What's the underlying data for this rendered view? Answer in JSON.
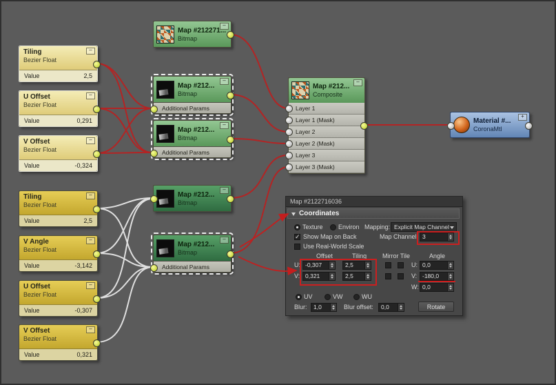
{
  "glyphs": {
    "collapse": "–",
    "add": "+"
  },
  "float_nodes": [
    {
      "title": "Tiling",
      "type": "Bezier Float",
      "param": "Value",
      "value": "2,5"
    },
    {
      "title": "U Offset",
      "type": "Bezier Float",
      "param": "Value",
      "value": "0,291"
    },
    {
      "title": "V Offset",
      "type": "Bezier Float",
      "param": "Value",
      "value": "-0,324"
    },
    {
      "title": "Tiling",
      "type": "Bezier Float",
      "param": "Value",
      "value": "2,5"
    },
    {
      "title": "V Angle",
      "type": "Bezier Float",
      "param": "Value",
      "value": "-3,142"
    },
    {
      "title": "U Offset",
      "type": "Bezier Float",
      "param": "Value",
      "value": "-0,307"
    },
    {
      "title": "V Offset",
      "type": "Bezier Float",
      "param": "Value",
      "value": "0,321"
    }
  ],
  "bitmap_nodes": [
    {
      "title": "Map #212271...",
      "type": "Bitmap"
    },
    {
      "title": "Map #212...",
      "type": "Bitmap",
      "params": "Additional Params"
    },
    {
      "title": "Map #212...",
      "type": "Bitmap",
      "params": "Additional Params"
    },
    {
      "title": "Map #212...",
      "type": "Bitmap"
    },
    {
      "title": "Map #212...",
      "type": "Bitmap",
      "params": "Additional Params"
    }
  ],
  "composite_node": {
    "title": "Map #212...",
    "type": "Composite",
    "slots": [
      "Layer 1",
      "Layer 1 (Mask)",
      "Layer 2",
      "Layer 2 (Mask)",
      "Layer 3",
      "Layer 3 (Mask)"
    ]
  },
  "material_node": {
    "title": "Material #...",
    "type": "CoronaMtl"
  },
  "panel": {
    "title": "Map #2122716036",
    "rollout": "Coordinates",
    "texture": "Texture",
    "environ": "Environ",
    "mapping_label": "Mapping:",
    "mapping_value": "Explicit Map Channel",
    "show_map_on_back": "Show Map on Back",
    "map_channel_label": "Map Channel:",
    "map_channel_value": "3",
    "use_real_world_scale": "Use Real-World Scale",
    "columns": {
      "offset": "Offset",
      "tiling": "Tiling",
      "mirror_tile": "Mirror Tile",
      "angle": "Angle"
    },
    "rows": {
      "u_label": "U:",
      "v_label": "V:",
      "w_label": "W:",
      "u_offset": "-0,307",
      "u_tiling": "2,5",
      "u_angle": "0,0",
      "v_offset": "0,321",
      "v_tiling": "2,5",
      "v_angle": "-180,0",
      "w_angle": "0,0"
    },
    "uvw": {
      "uv": "UV",
      "vw": "VW",
      "wu": "WU"
    },
    "blur_label": "Blur:",
    "blur_value": "1,0",
    "blur_offset_label": "Blur offset:",
    "blur_offset_value": "0,0",
    "rotate_button": "Rotate"
  },
  "colors": {
    "wire_red": "#b32424",
    "wire_white": "#e0e0e0",
    "annotation_red": "#c41e1e",
    "background": "#5b5b5b"
  }
}
